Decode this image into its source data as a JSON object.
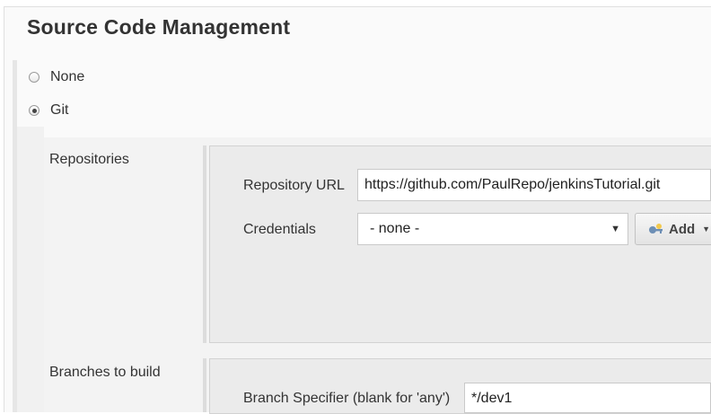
{
  "section": {
    "title": "Source Code Management"
  },
  "scm_options": [
    {
      "label": "None",
      "selected": false
    },
    {
      "label": "Git",
      "selected": true
    }
  ],
  "repositories": {
    "label": "Repositories",
    "repository_url": {
      "label": "Repository URL",
      "value": "https://github.com/PaulRepo/jenkinsTutorial.git"
    },
    "credentials": {
      "label": "Credentials",
      "selected": "- none -",
      "add_button_label": "Add"
    }
  },
  "branches": {
    "label": "Branches to build",
    "branch_specifier": {
      "label": "Branch Specifier (blank for 'any')",
      "value": "*/dev1"
    }
  },
  "icons": {
    "add_button_icon": "key-icon",
    "dropdown_icon": "chevron-down-icon"
  }
}
